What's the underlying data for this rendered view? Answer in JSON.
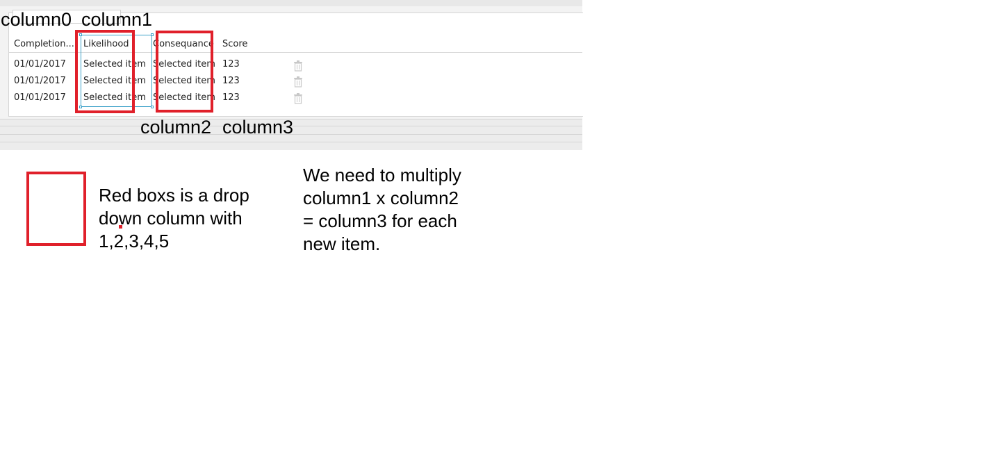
{
  "annotations": {
    "column0": "column0",
    "column1": "column1",
    "column2": "column2",
    "column3": "column3"
  },
  "table": {
    "headers": [
      "Completion...",
      "Likelihood",
      "Consequance",
      "Score"
    ],
    "rows": [
      {
        "date": "01/01/2017",
        "likelihood": "Selected item",
        "consequence": "Selected item",
        "score": "123"
      },
      {
        "date": "01/01/2017",
        "likelihood": "Selected item",
        "consequence": "Selected item",
        "score": "123"
      },
      {
        "date": "01/01/2017",
        "likelihood": "Selected item",
        "consequence": "Selected item",
        "score": "123"
      }
    ]
  },
  "legend": {
    "lines": [
      "Red boxs is a drop",
      "down column with",
      "1,2,3,4,5"
    ]
  },
  "note": {
    "lines": [
      "We need to multiply",
      "column1 x column2",
      "= column3 for each",
      "new item."
    ]
  },
  "colors": {
    "annotation_red": "#e0202a",
    "selection_blue": "#3aa0c8"
  },
  "icons": {
    "row_delete": "trash-icon"
  }
}
